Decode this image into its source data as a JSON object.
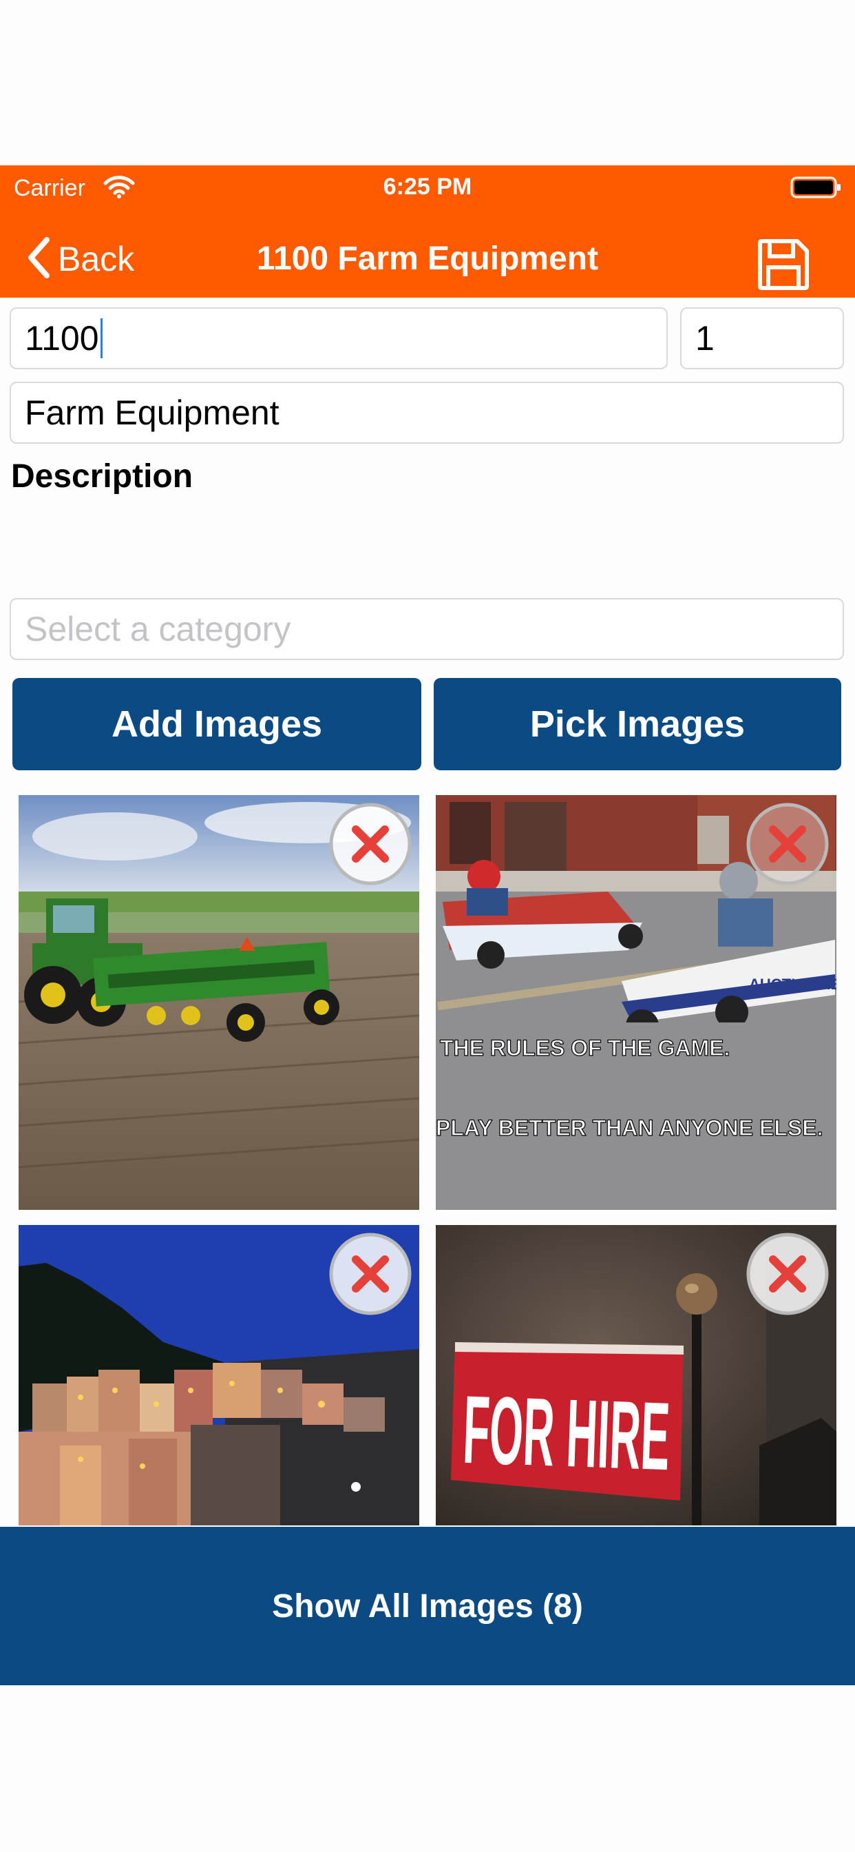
{
  "status_bar": {
    "carrier": "Carrier",
    "time": "6:25 PM"
  },
  "nav": {
    "back_label": "Back",
    "title": "1100 Farm Equipment"
  },
  "form": {
    "lot_number_value": "1100",
    "quantity_value": "1",
    "title_value": "Farm Equipment",
    "description_label": "Description",
    "category_placeholder": "Select a category"
  },
  "buttons": {
    "add_images": "Add Images",
    "pick_images": "Pick Images",
    "show_all_images": "Show All Images (8)"
  },
  "images": [
    {
      "subject": "green farm tractor with seed drill in a field",
      "caption_lines": []
    },
    {
      "subject": "kids racing soapbox cars on a street",
      "caption_lines": [
        "THE RULES OF THE GAME.",
        "PLAY BETTER THAN ANYONE ELSE."
      ],
      "logo_text": "AUCTIONMETH"
    },
    {
      "subject": "coastal cliff village at dusk",
      "caption_lines": []
    },
    {
      "subject": "red FOR HIRE sign on a post",
      "sign_text": "FOR HIRE"
    }
  ],
  "colors": {
    "accent": "#ff5a00",
    "primary_button": "#0c4a84",
    "remove_icon": "#e5413a"
  }
}
